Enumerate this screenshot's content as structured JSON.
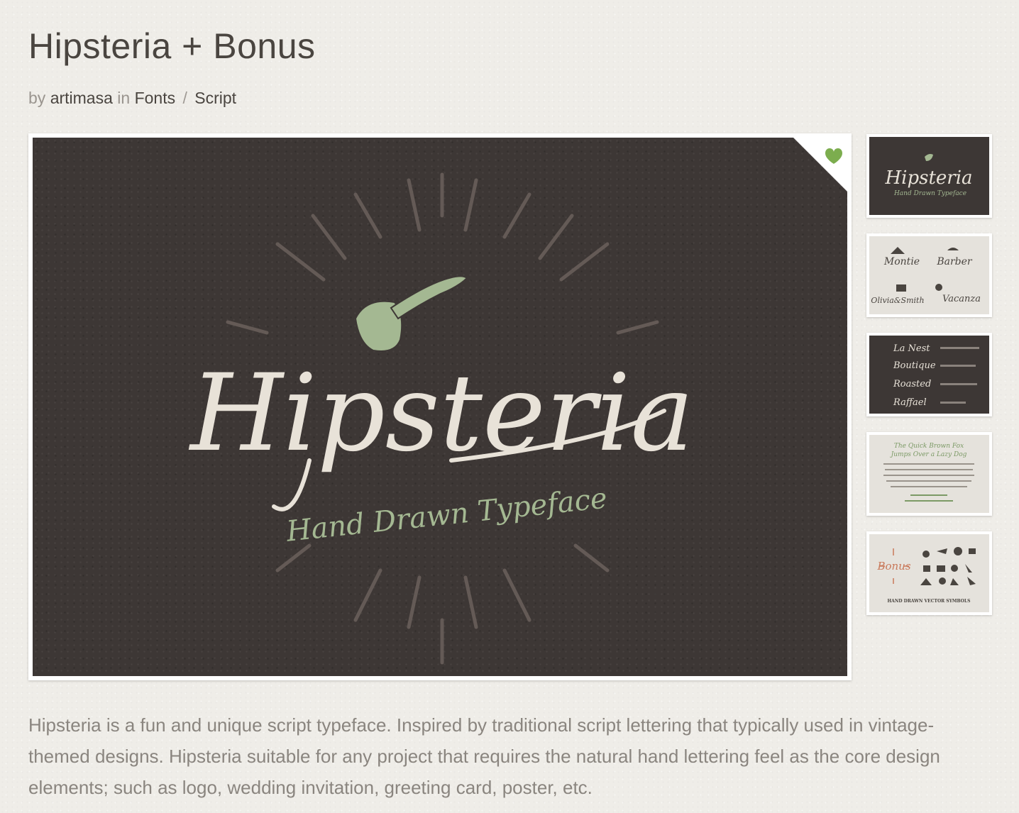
{
  "page": {
    "title": "Hipsteria + Bonus",
    "by_label": "by",
    "author": "artimasa",
    "in_label": "in",
    "category": "Fonts",
    "separator": "/",
    "subcategory": "Script"
  },
  "main_image": {
    "script_title": "Hipsteria",
    "tagline": "Hand Drawn Typeface",
    "favorite_icon": "heart-icon",
    "favorite_color": "#7cad4e"
  },
  "thumbnails": [
    {
      "lines": [
        "Hipsteria",
        "Hand Drawn Typeface"
      ]
    },
    {
      "lines": [
        "Montie",
        "Barber",
        "Olivia&Smith",
        "Vacanza"
      ]
    },
    {
      "lines": [
        "La Nest",
        "Boutique",
        "Roasted",
        "Raffael"
      ]
    },
    {
      "lines": [
        "The Quick Brown Fox",
        "Jumps Over a Lazy Dog"
      ]
    },
    {
      "lines": [
        "Bonus",
        "HAND DRAWN VECTOR SYMBOLS"
      ]
    }
  ],
  "description": "Hipsteria is a fun and unique script typeface. Inspired by traditional script lettering that typically used in vintage-themed designs. Hipsteria suitable for any project that requires the natural hand lettering feel as the core design elements; such as logo, wedding invitation, greeting card, poster, etc.",
  "colors": {
    "background": "#efede8",
    "dark_panel": "#3d3735",
    "script_text": "#e8e2d8",
    "accent_green": "#a4b892",
    "heart_green": "#7cad4e"
  }
}
